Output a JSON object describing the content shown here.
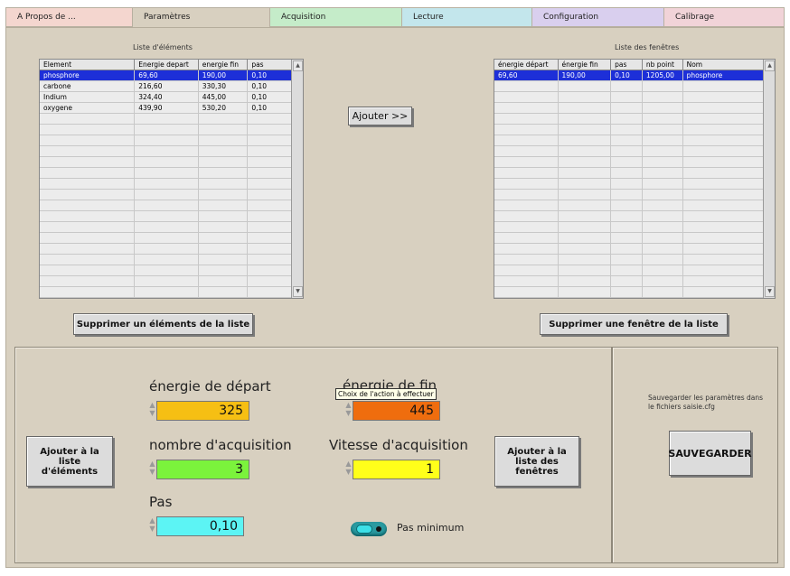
{
  "tabs": [
    {
      "label": "A Propos de ...",
      "color": "#f4d6cf"
    },
    {
      "label": "Paramètres",
      "color": "#d8d0c0"
    },
    {
      "label": "Acquisition",
      "color": "#c5ecc9"
    },
    {
      "label": "Lecture",
      "color": "#c3e6ec"
    },
    {
      "label": "Configuration",
      "color": "#d9cfee"
    },
    {
      "label": "Calibrage",
      "color": "#f1d3d8"
    }
  ],
  "element_list": {
    "title": "Liste d'éléments",
    "columns": [
      "Element",
      "Energie depart",
      "energie fin",
      "pas"
    ],
    "rows": [
      [
        "phosphore",
        "69,60",
        "190,00",
        "0,10"
      ],
      [
        "carbone",
        "216,60",
        "330,30",
        "0,10"
      ],
      [
        "Indium",
        "324,40",
        "445,00",
        "0,10"
      ],
      [
        "oxygene",
        "439,90",
        "530,20",
        "0,10"
      ]
    ],
    "selected_row": 0,
    "delete_button": "Supprimer un éléments de la liste"
  },
  "window_list": {
    "title": "Liste des fenêtres",
    "columns": [
      "énergie départ",
      "énergie fin",
      "pas",
      "nb point",
      "Nom"
    ],
    "rows": [
      [
        "69,60",
        "190,00",
        "0,10",
        "1205,00",
        "phosphore"
      ]
    ],
    "selected_row": 0,
    "delete_button": "Supprimer une fenêtre de la liste"
  },
  "add_button": "Ajouter >>",
  "form": {
    "start_energy_label": "énergie de départ",
    "start_energy_value": "325",
    "end_energy_label": "énergie de fin",
    "end_energy_value": "445",
    "tooltip": "Choix de l'action à effectuer",
    "acq_count_label": "nombre d'acquisition",
    "acq_count_value": "3",
    "acq_speed_label": "Vitesse d'acquisition",
    "acq_speed_value": "1",
    "step_label": "Pas",
    "step_value": "0,10",
    "add_to_elements_button": "Ajouter à la liste d'éléments",
    "add_to_windows_button": "Ajouter à la liste des fenêtres",
    "min_step_label": "Pas minimum"
  },
  "save": {
    "note": "Sauvegarder les paramètres dans le fichiers saisie.cfg",
    "button": "SAUVEGARDER"
  },
  "colors": {
    "start_energy": "#f6bf13",
    "end_energy": "#ef6d0e",
    "acq_count": "#7bf33c",
    "acq_speed": "#ffff1a",
    "step": "#5cf4f4",
    "selection": "#1d2fd8"
  }
}
